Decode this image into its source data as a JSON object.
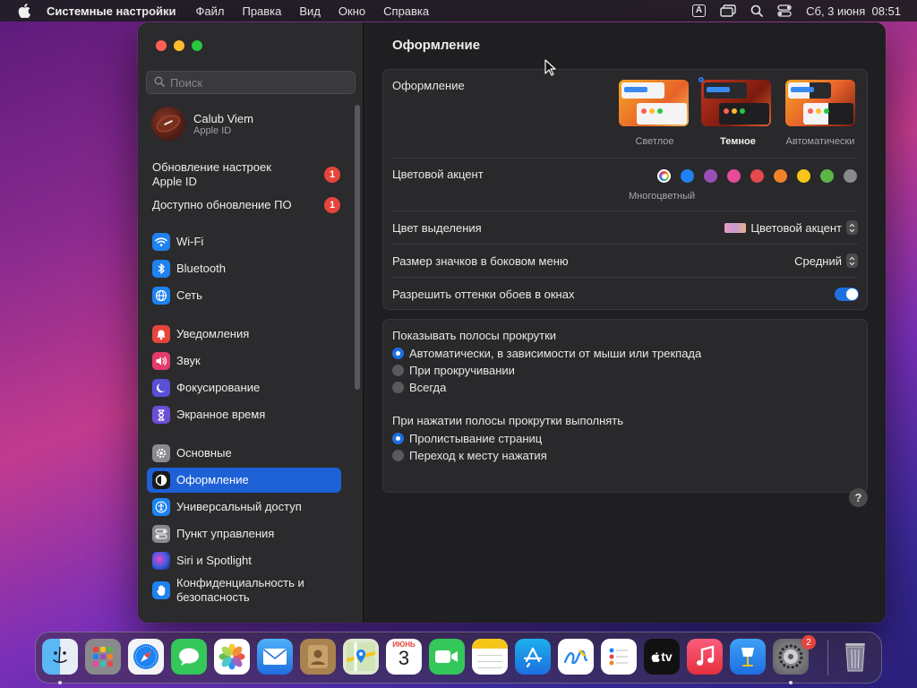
{
  "menubar": {
    "app_name": "Системные настройки",
    "menus": [
      "Файл",
      "Правка",
      "Вид",
      "Окно",
      "Справка"
    ],
    "keyboard_layout": "A",
    "datetime": "Сб, 3 июня  08:51"
  },
  "sidebar": {
    "search_placeholder": "Поиск",
    "account": {
      "name": "Calub Viem",
      "subtitle": "Apple ID"
    },
    "notices": [
      {
        "label": "Обновление настроек Apple ID",
        "badge": "1"
      },
      {
        "label": "Доступно обновление ПО",
        "badge": "1"
      }
    ],
    "items": [
      {
        "label": "Wi-Fi",
        "icon": "wifi-icon",
        "color": "#1e82f0"
      },
      {
        "label": "Bluetooth",
        "icon": "bluetooth-icon",
        "color": "#1e82f0"
      },
      {
        "label": "Сеть",
        "icon": "globe-icon",
        "color": "#1e82f0"
      },
      {
        "label": "Уведомления",
        "icon": "bell-icon",
        "color": "#e5453b"
      },
      {
        "label": "Звук",
        "icon": "speaker-icon",
        "color": "#e53b6a"
      },
      {
        "label": "Фокусирование",
        "icon": "moon-icon",
        "color": "#5a4fd6"
      },
      {
        "label": "Экранное время",
        "icon": "hourglass-icon",
        "color": "#6a4fd6"
      },
      {
        "label": "Основные",
        "icon": "gear-icon",
        "color": "#8a8a8e"
      },
      {
        "label": "Оформление",
        "icon": "appearance-icon",
        "color": "#1a1a1a"
      },
      {
        "label": "Универсальный доступ",
        "icon": "accessibility-icon",
        "color": "#1e82f0"
      },
      {
        "label": "Пункт управления",
        "icon": "control-center-icon",
        "color": "#8a8a8e"
      },
      {
        "label": "Siri и Spotlight",
        "icon": "siri-icon",
        "color": "#3a3a8a"
      },
      {
        "label": "Конфиденциальность и безопасность",
        "icon": "hand-icon",
        "color": "#1e82f0"
      }
    ],
    "selected": "Оформление"
  },
  "main": {
    "title": "Оформление",
    "appearance": {
      "label": "Оформление",
      "options": [
        {
          "label": "Светлое",
          "selected": false
        },
        {
          "label": "Темное",
          "selected": true
        },
        {
          "label": "Автоматически",
          "selected": false
        }
      ]
    },
    "accent": {
      "label": "Цветовой акцент",
      "colors": [
        "multicolor",
        "#1e82f0",
        "#9b4fb5",
        "#e74a97",
        "#e5484d",
        "#f0832a",
        "#f5c518",
        "#5ab547",
        "#8a8a8e"
      ],
      "selected_caption": "Многоцветный"
    },
    "highlight": {
      "label": "Цвет выделения",
      "value": "Цветовой акцент"
    },
    "sidebar_icon_size": {
      "label": "Размер значков в боковом меню",
      "value": "Средний"
    },
    "wallpaper_tinting": {
      "label": "Разрешить оттенки обоев в окнах",
      "enabled": true
    },
    "scrollbars": {
      "heading": "Показывать полосы прокрутки",
      "options": [
        {
          "label": "Автоматически, в зависимости от мыши или трекпада",
          "selected": true
        },
        {
          "label": "При прокручивании",
          "selected": false
        },
        {
          "label": "Всегда",
          "selected": false
        }
      ]
    },
    "click_scrollbar": {
      "heading": "При нажатии полосы прокрутки выполнять",
      "options": [
        {
          "label": "Пролистывание страниц",
          "selected": true
        },
        {
          "label": "Переход к месту нажатия",
          "selected": false
        }
      ]
    },
    "help": "?"
  },
  "dock": {
    "apps": [
      "finder",
      "launchpad",
      "safari",
      "messages",
      "photos",
      "mail",
      "contacts",
      "maps",
      "calendar",
      "facetime",
      "notes",
      "app-store",
      "freeform",
      "reminders",
      "apple-tv",
      "music",
      "keynote",
      "system-settings",
      "trash"
    ],
    "calendar": {
      "month": "ИЮНЬ",
      "day": "3"
    },
    "appletv_label": "tv",
    "settings_badge": "2"
  }
}
